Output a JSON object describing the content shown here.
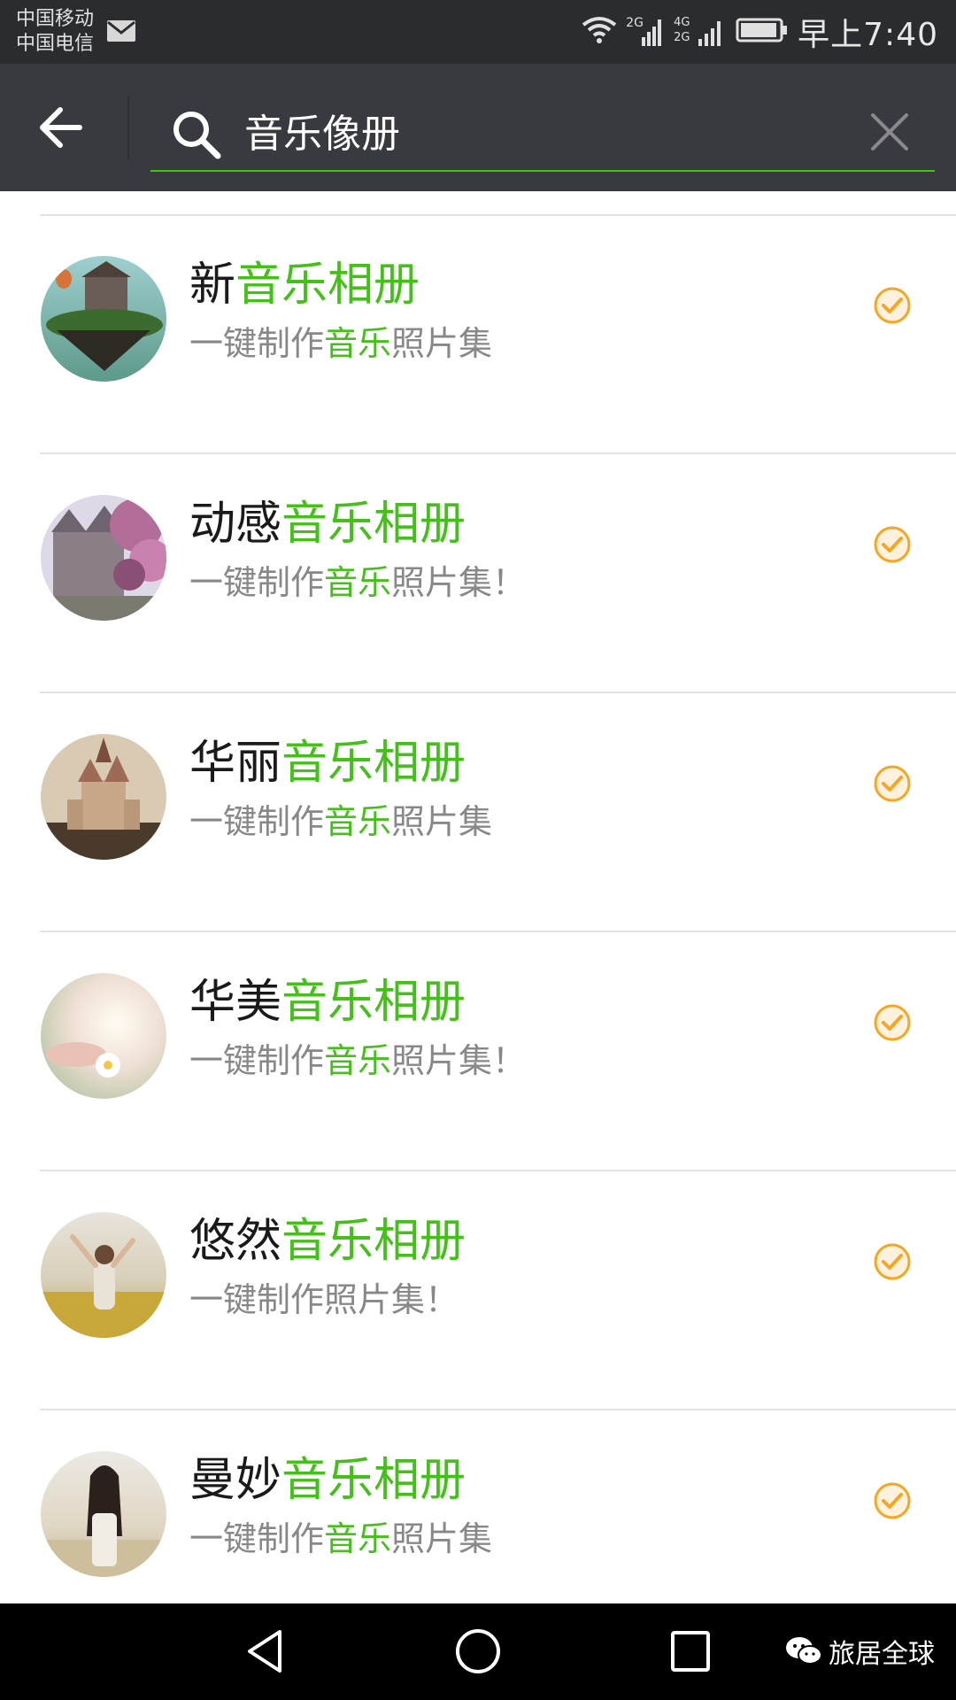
{
  "status_bar": {
    "carrier_1": "中国移动",
    "carrier_2": "中国电信",
    "network_1": "2G",
    "network_2": "4G",
    "network_3": "2G",
    "time": "早上7:40"
  },
  "search": {
    "query": "音乐像册",
    "highlight_color": "#45c01a"
  },
  "results": [
    {
      "title_plain": "新",
      "title_hl": "音乐相册",
      "desc_1": "一键制作",
      "desc_hl": "音乐",
      "desc_2": "照片集",
      "check_color": "#f5a623"
    },
    {
      "title_plain": "动感",
      "title_hl": "音乐相册",
      "desc_1": "一键制作",
      "desc_hl": "音乐",
      "desc_2": "照片集！",
      "check_color": "#f5a623"
    },
    {
      "title_plain": "华丽",
      "title_hl": "音乐相册",
      "desc_1": "一键制作",
      "desc_hl": "音乐",
      "desc_2": "照片集",
      "check_color": "#f5a623"
    },
    {
      "title_plain": "华美",
      "title_hl": "音乐相册",
      "desc_1": "一键制作",
      "desc_hl": "音乐",
      "desc_2": "照片集！",
      "check_color": "#f5a623"
    },
    {
      "title_plain": "悠然",
      "title_hl": "音乐相册",
      "desc_1": "一键制作照片集！",
      "desc_hl": "",
      "desc_2": "",
      "check_color": "#f5a623"
    },
    {
      "title_plain": "曼妙",
      "title_hl": "音乐相册",
      "desc_1": "一键制作",
      "desc_hl": "音乐",
      "desc_2": "照片集",
      "check_color": "#f5a623"
    }
  ],
  "watermark": {
    "text": "旅居全球"
  }
}
